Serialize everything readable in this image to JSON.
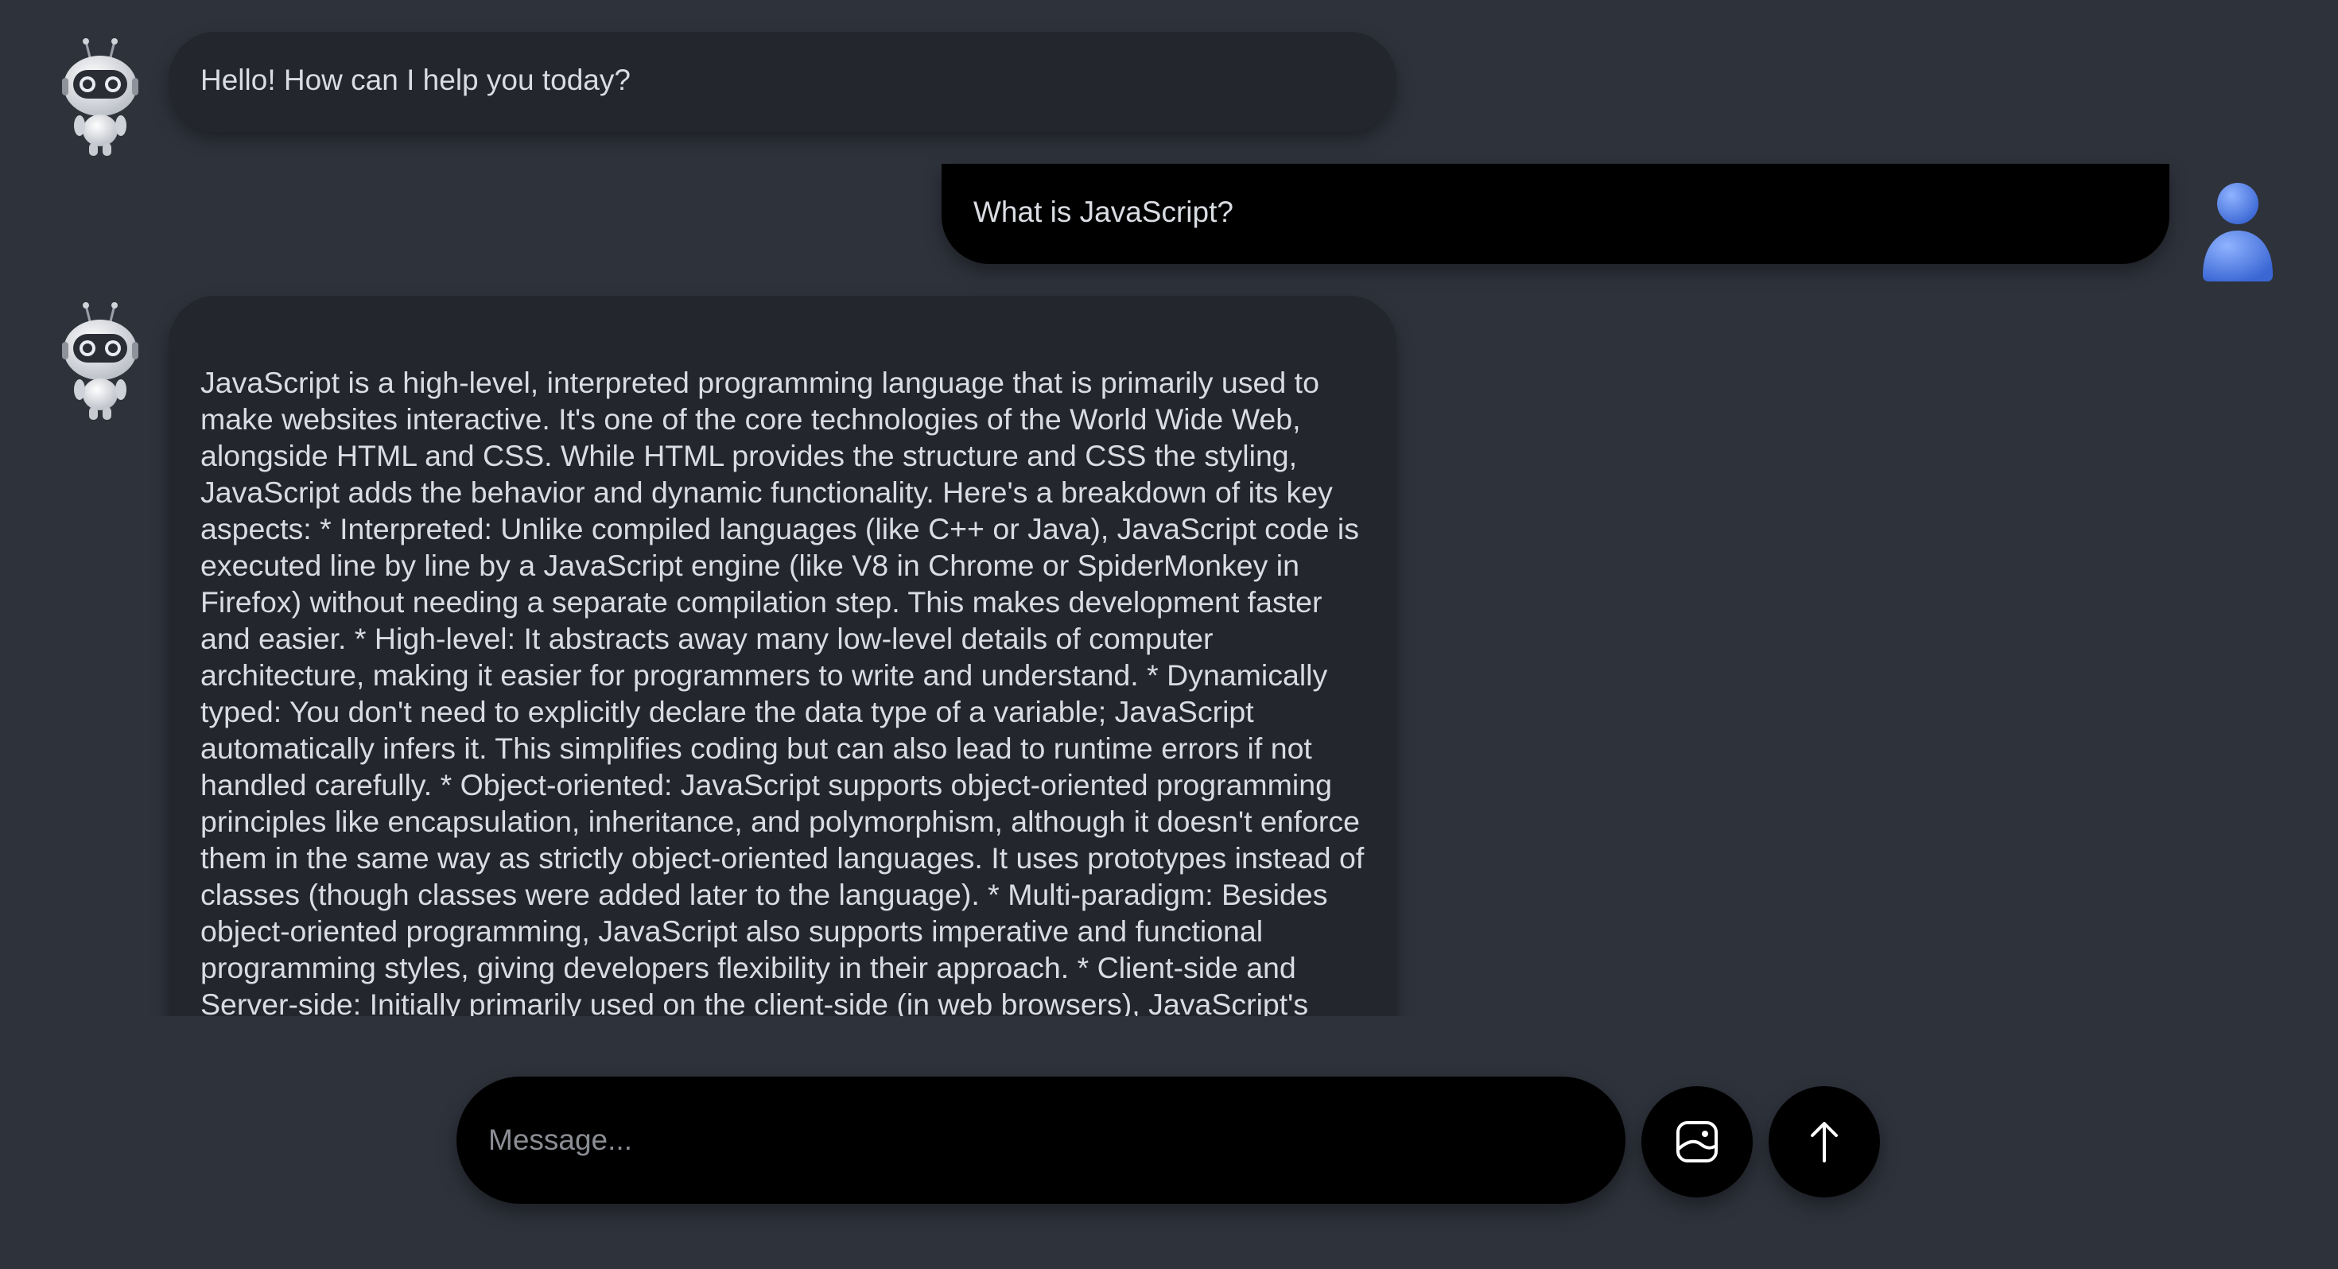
{
  "messages": [
    {
      "role": "bot",
      "avatar_icon": "robot-icon",
      "text": "Hello! How can I help you today?"
    },
    {
      "role": "user",
      "avatar_icon": "user-icon",
      "text": "What is JavaScript?"
    },
    {
      "role": "bot",
      "avatar_icon": "robot-icon",
      "text": "JavaScript is a high-level, interpreted programming language that is primarily used to make websites interactive. It's one of the core technologies of the World Wide Web, alongside HTML and CSS. While HTML provides the structure and CSS the styling, JavaScript adds the behavior and dynamic functionality. Here's a breakdown of its key aspects: * Interpreted: Unlike compiled languages (like C++ or Java), JavaScript code is executed line by line by a JavaScript engine (like V8 in Chrome or SpiderMonkey in Firefox) without needing a separate compilation step. This makes development faster and easier. * High-level: It abstracts away many low-level details of computer architecture, making it easier for programmers to write and understand. * Dynamically typed: You don't need to explicitly declare the data type of a variable; JavaScript automatically infers it. This simplifies coding but can also lead to runtime errors if not handled carefully. * Object-oriented: JavaScript supports object-oriented programming principles like encapsulation, inheritance, and polymorphism, although it doesn't enforce them in the same way as strictly object-oriented languages. It uses prototypes instead of classes (though classes were added later to the language). * Multi-paradigm: Besides object-oriented programming, JavaScript also supports imperative and functional programming styles, giving developers flexibility in their approach. * Client-side and Server-side: Initially primarily used on the client-side (in web browsers), JavaScript's capabilities have expanded significantly. Node.js allows running JavaScript on servers, enabling backend development. * Extensive Ecosystem: JavaScript has"
    }
  ],
  "composer": {
    "placeholder": "Message...",
    "value": "",
    "image_button_icon": "image-upload-icon",
    "send_button_icon": "arrow-up-icon"
  },
  "colors": {
    "background": "#2e323b",
    "bot_bubble": "#23262c",
    "user_bubble": "#000000",
    "text": "#d9dce2",
    "placeholder": "#8a8d93",
    "user_avatar": "#4f7fe0"
  }
}
